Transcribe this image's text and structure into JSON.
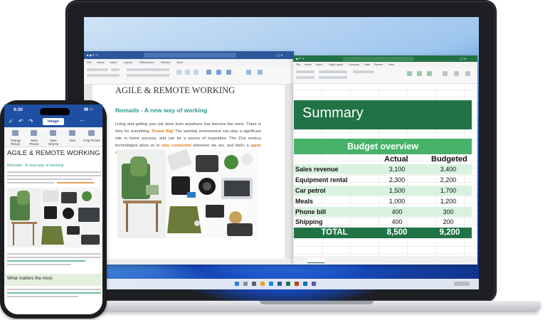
{
  "colors": {
    "word_blue": "#2b579a",
    "excel_green": "#217346",
    "budget_green": "#47b36a",
    "row_light": "#d9f2df",
    "accent_orange": "#e07a14",
    "teal": "#2a9a8a"
  },
  "word": {
    "doc_title": "AGILE & REMOTE WORKING",
    "subtitle": "Nomads - A new way of working",
    "body_1": "Living and getting your job done from anywhere has become the norm. There is time for everything. ",
    "highlight_1": "Dream Big!",
    "body_2": " The working environment can play a significant role in home success, and can be a source of inspiration. The 21st century technologies allow us to ",
    "highlight_2": "stay connected",
    "body_3": " wherever we are, and that's a ",
    "highlight_3": "game changer",
    "body_4": "!"
  },
  "excel": {
    "title": "Summary",
    "budget_header": "Budget overview",
    "col_actual": "Actual",
    "col_budgeted": "Budgeted",
    "rows": [
      {
        "label": "Sales revenue",
        "actual": "3,100",
        "budgeted": "3,400"
      },
      {
        "label": "Equipment rental",
        "actual": "2,300",
        "budgeted": "2,200"
      },
      {
        "label": "Car petrol",
        "actual": "1,500",
        "budgeted": "1,700"
      },
      {
        "label": "Meals",
        "actual": "1,000",
        "budgeted": "1,200"
      },
      {
        "label": "Phone bill",
        "actual": "400",
        "budgeted": "300"
      },
      {
        "label": "Shipping",
        "actual": "400",
        "budgeted": "200"
      }
    ],
    "total_label": "TOTAL",
    "total_actual": "8,500",
    "total_budgeted": "9,200"
  },
  "phone": {
    "time": "9:30",
    "image_button": "Image",
    "actions": [
      "Change Picture",
      "Save Picture",
      "Save OnlyHe",
      "Size",
      "Crop Picture"
    ],
    "doc_title": "AGILE & REMOTE WORKING",
    "subtitle": "Nomads - A new way of working",
    "section_heading": "What matters the most"
  }
}
